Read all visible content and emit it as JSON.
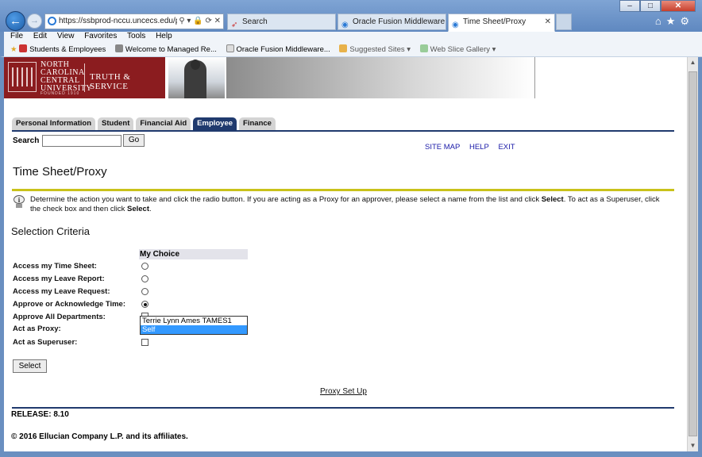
{
  "browser": {
    "address": "https://ssbprod-nccu.uncecs.edu/pls/NC",
    "tabs": [
      {
        "title": "Search",
        "active": false
      },
      {
        "title": "Oracle Fusion Middleware For...",
        "active": false
      },
      {
        "title": "Time Sheet/Proxy",
        "active": true
      }
    ],
    "menu": [
      "File",
      "Edit",
      "View",
      "Favorites",
      "Tools",
      "Help"
    ],
    "favorites": [
      "Students & Employees",
      "Welcome to Managed Re...",
      "Oracle Fusion Middleware...",
      "Suggested Sites ▾",
      "Web Slice Gallery ▾"
    ]
  },
  "banner": {
    "university_lines": [
      "NORTH",
      "CAROLINA",
      "CENTRAL",
      "UNIVERSITY"
    ],
    "founded": "FOUNDED 1910",
    "motto": "TRUTH & SERVICE"
  },
  "nav": {
    "tabs": [
      "Personal Information",
      "Student",
      "Financial Aid",
      "Employee",
      "Finance"
    ],
    "active_tab": "Employee",
    "search_label": "Search",
    "go_label": "Go",
    "links": [
      "SITE MAP",
      "HELP",
      "EXIT"
    ]
  },
  "page": {
    "title": "Time Sheet/Proxy",
    "info_part1": "Determine the action you want to take and click the radio button. If you are acting as a Proxy for an approver, please select a name from the list and click ",
    "info_bold1": "Select",
    "info_part2": ". To act as a Superuser, click the check box and then click ",
    "info_bold2": "Select",
    "info_part3": ".",
    "section_title": "Selection Criteria",
    "choice_header": "My Choice",
    "rows": [
      {
        "label": "Access my Time Sheet:",
        "control": "radio",
        "checked": false
      },
      {
        "label": "Access my Leave Report:",
        "control": "radio",
        "checked": false
      },
      {
        "label": "Access my Leave Request:",
        "control": "radio",
        "checked": false
      },
      {
        "label": "Approve or Acknowledge Time:",
        "control": "radio",
        "checked": true
      },
      {
        "label": "Approve All Departments:",
        "control": "checkbox",
        "checked": false
      },
      {
        "label": "Act as Proxy:",
        "control": "select"
      },
      {
        "label": "Act as Superuser:",
        "control": "checkbox",
        "checked": false
      }
    ],
    "proxy_options": [
      "Terrie Lynn Ames TAMES1",
      "Self"
    ],
    "proxy_selected": "Self",
    "select_button": "Select",
    "proxy_setup_link": "Proxy Set Up",
    "release": "RELEASE: 8.10",
    "copyright": "© 2016 Ellucian Company L.P. and its affiliates."
  }
}
